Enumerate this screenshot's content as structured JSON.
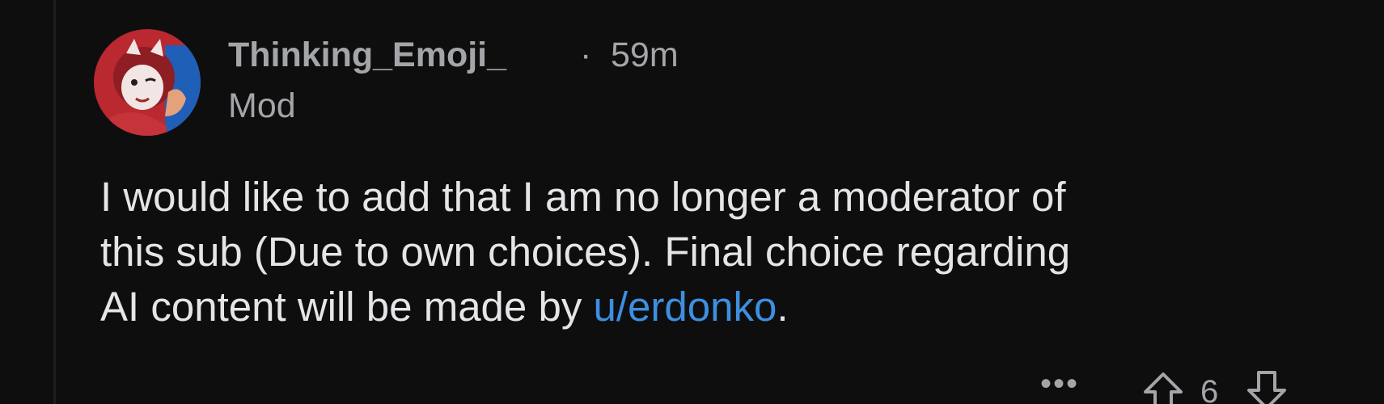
{
  "comment": {
    "author": "Thinking_Emoji_",
    "separator": "·",
    "time": "59m",
    "flair": "Mod",
    "body": {
      "line1": "I would like to add that I am no longer a moderator of",
      "line2": "this sub (Due to own choices). Final choice regarding",
      "line3_before": "AI content will be made by ",
      "mention": "u/erdonko",
      "line3_after": "."
    },
    "actions": {
      "more_label": "•••",
      "score": "6"
    }
  },
  "icons": {
    "avatar": "user-avatar",
    "more": "more-options-icon",
    "upvote": "upvote-arrow-icon",
    "downvote": "downvote-arrow-icon"
  },
  "colors": {
    "background": "#0e0e0f",
    "meta_text": "#a3a5a8",
    "body_text": "#e4e5e7",
    "link": "#3d8fe0"
  }
}
